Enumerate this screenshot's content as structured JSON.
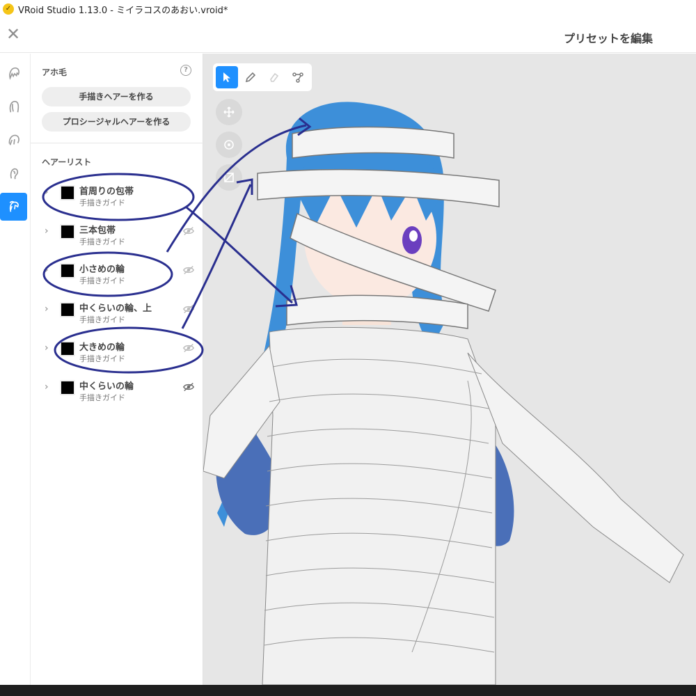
{
  "window": {
    "title": "VRoid Studio 1.13.0 - ミイラコスのあおい.vroid*"
  },
  "header": {
    "preset_title": "プリセットを編集"
  },
  "panel": {
    "section_title": "アホ毛",
    "buttons": {
      "hand_drawn": "手描きヘアーを作る",
      "procedural": "プロシージャルヘアーを作る"
    },
    "hair_list_title": "ヘアーリスト",
    "hair_items": [
      {
        "name": "首周りの包帯",
        "type": "手描きガイド",
        "swatch": "#000000"
      },
      {
        "name": "三本包帯",
        "type": "手描きガイド",
        "swatch": "#000000"
      },
      {
        "name": "小さめの輪",
        "type": "手描きガイド",
        "swatch": "#000000"
      },
      {
        "name": "中くらいの輪、上",
        "type": "手描きガイド",
        "swatch": "#000000"
      },
      {
        "name": "大きめの輪",
        "type": "手描きガイド",
        "swatch": "#000000"
      },
      {
        "name": "中くらいの輪",
        "type": "手描きガイド",
        "swatch": "#000000"
      }
    ]
  },
  "colors": {
    "accent": "#1e90ff",
    "annotation": "#2a2f8f",
    "hair": "#3d8fd9",
    "bandage": "#f4f4f4"
  }
}
